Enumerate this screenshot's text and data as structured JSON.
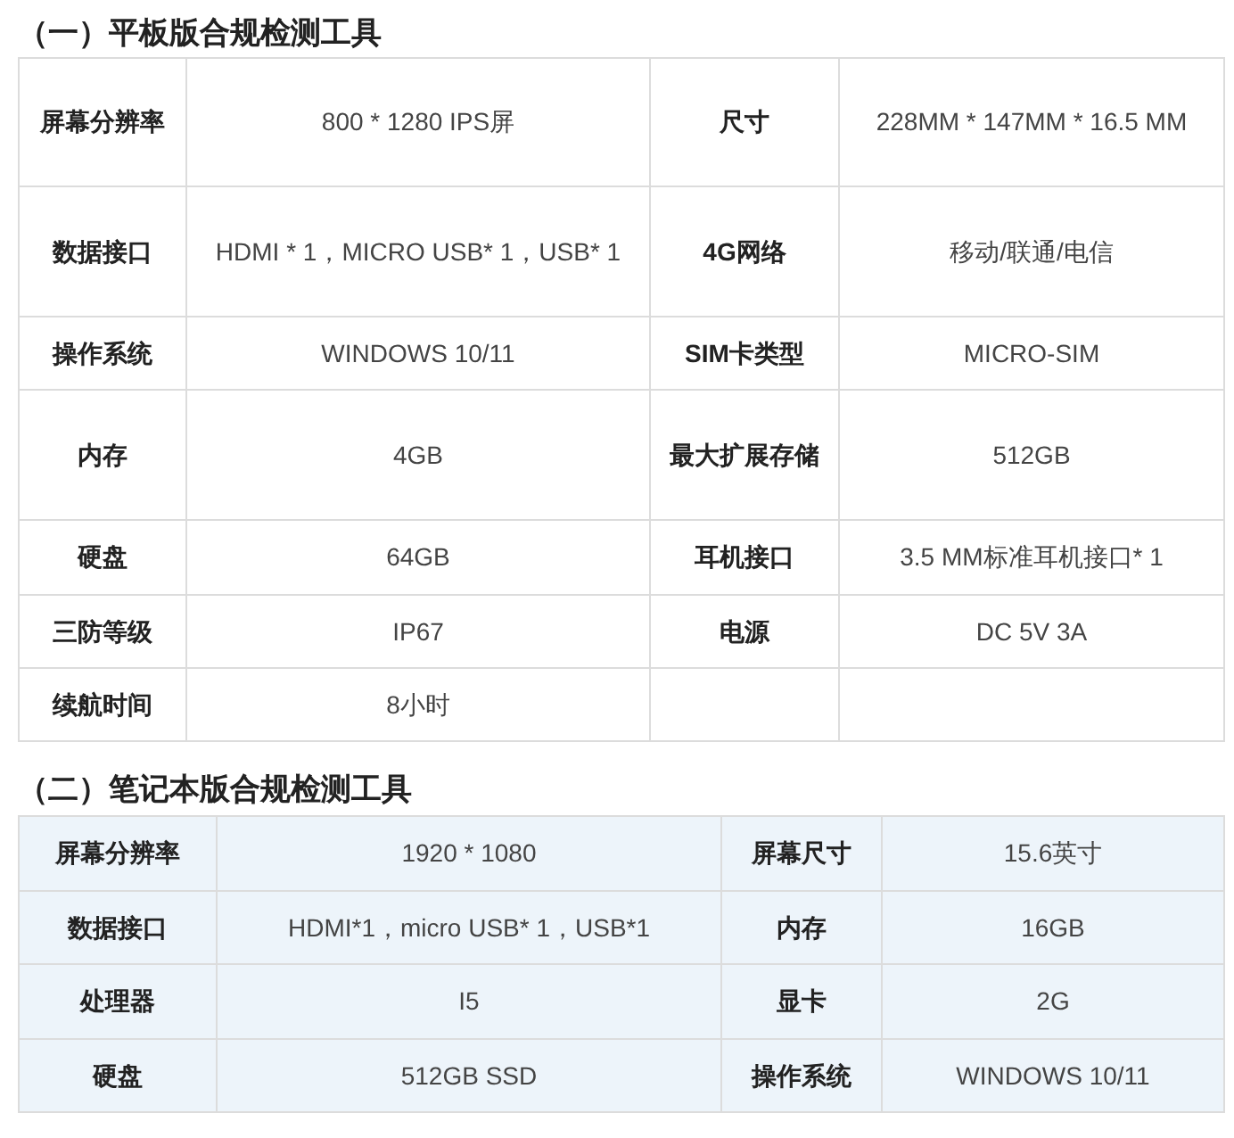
{
  "sections": [
    {
      "title": "（一）平板版合规检测工具",
      "shaded": false,
      "rows": [
        {
          "label_1": "屏幕分辨率",
          "value_1": "800 * 1280 IPS屏",
          "label_2": "尺寸",
          "value_2": "228MM * 147MM * 16.5 MM"
        },
        {
          "label_1": "数据接口",
          "value_1": "HDMI * 1，MICRO USB* 1，USB* 1",
          "label_2": "4G网络",
          "value_2": "移动/联通/电信"
        },
        {
          "label_1": "操作系统",
          "value_1": "WINDOWS 10/11",
          "label_2": "SIM卡类型",
          "value_2": "MICRO-SIM"
        },
        {
          "label_1": "内存",
          "value_1": "4GB",
          "label_2": "最大扩展存储",
          "value_2": "512GB"
        },
        {
          "label_1": "硬盘",
          "value_1": "64GB",
          "label_2": "耳机接口",
          "value_2": "3.5 MM标准耳机接口* 1"
        },
        {
          "label_1": "三防等级",
          "value_1": "IP67",
          "label_2": "电源",
          "value_2": "DC 5V 3A"
        },
        {
          "label_1": "续航时间",
          "value_1": "8小时"
        }
      ]
    },
    {
      "title": "（二）笔记本版合规检测工具",
      "shaded": true,
      "rows": [
        {
          "label_1": "屏幕分辨率",
          "value_1": "1920 * 1080",
          "label_2": "屏幕尺寸",
          "value_2": "15.6英寸"
        },
        {
          "label_1": "数据接口",
          "value_1": "HDMI*1，micro USB* 1，USB*1",
          "label_2": "内存",
          "value_2": "16GB"
        },
        {
          "label_1": "处理器",
          "value_1": "I5",
          "label_2": "显卡",
          "value_2": "2G"
        },
        {
          "label_1": "硬盘",
          "value_1": "512GB SSD",
          "label_2": "操作系统",
          "value_2": "WINDOWS 10/11"
        }
      ]
    }
  ]
}
